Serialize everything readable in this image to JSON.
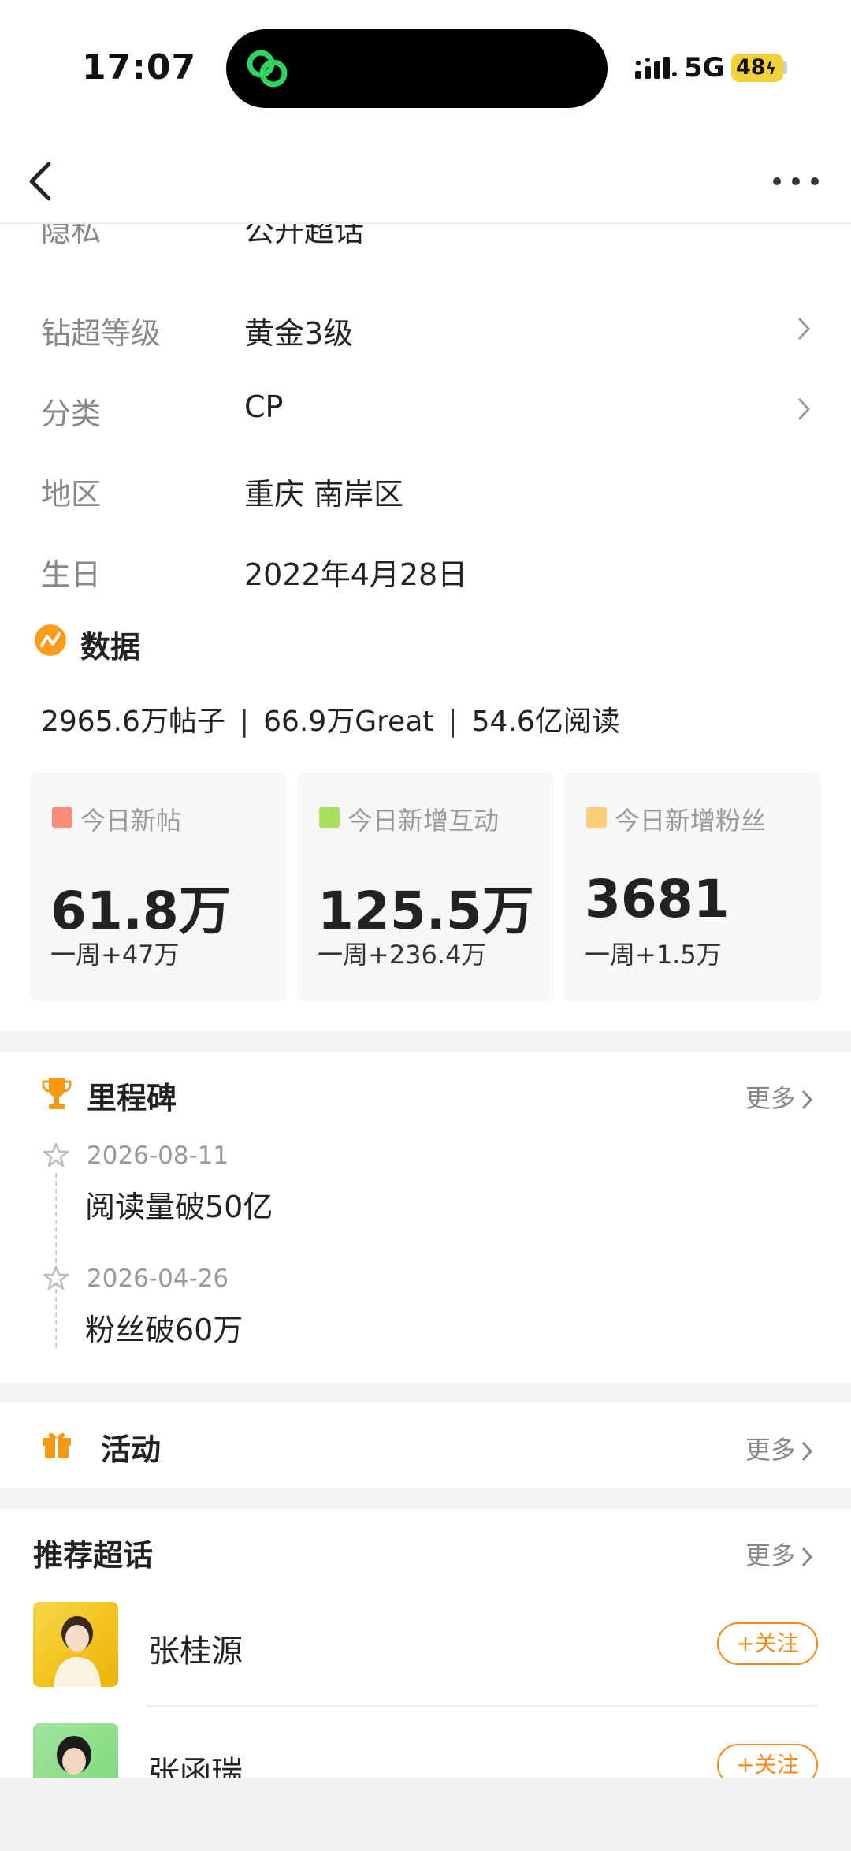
{
  "status_bar": {
    "time": "17:07",
    "network": "5G",
    "battery": "48"
  },
  "nav": {
    "back_icon": "back-chevron-icon",
    "more_icon": "more-dots-icon"
  },
  "info": {
    "rows": [
      {
        "label": "隐私",
        "value": "公开超话",
        "arrow": false
      },
      {
        "label": "钻超等级",
        "value": "黄金3级",
        "arrow": true
      },
      {
        "label": "分类",
        "value": "CP",
        "arrow": true
      },
      {
        "label": "地区",
        "value": "重庆 南岸区",
        "arrow": false
      },
      {
        "label": "生日",
        "value": "2022年4月28日",
        "arrow": false
      }
    ]
  },
  "data_section": {
    "title": "数据",
    "summary": {
      "posts": "2965.6万帖子",
      "sep": "|",
      "great": "66.9万Great",
      "reads": "54.6亿阅读"
    },
    "cards": [
      {
        "label": "今日新帖",
        "value": "61.8万",
        "week": "一周+47万",
        "color": "#f78c78"
      },
      {
        "label": "今日新增互动",
        "value": "125.5万",
        "week": "一周+236.4万",
        "color": "#a6e05c"
      },
      {
        "label": "今日新增粉丝",
        "value": "3681",
        "week": "一周+1.5万",
        "color": "#fbcc7a"
      }
    ]
  },
  "milestones": {
    "title": "里程碑",
    "more": "更多",
    "items": [
      {
        "date": "2026-08-11",
        "text": "阅读量破50亿"
      },
      {
        "date": "2026-04-26",
        "text": "粉丝破60万"
      }
    ]
  },
  "activity": {
    "title": "活动",
    "more": "更多"
  },
  "recommended": {
    "title": "推荐超话",
    "more": "更多",
    "items": [
      {
        "name": "张桂源",
        "follow": "+关注"
      },
      {
        "name": "张函瑞",
        "follow": "+关注"
      }
    ]
  },
  "colors": {
    "accent": "#f48a1c",
    "data_icon": "#ff9a1a",
    "battery": "#f2d13a",
    "island_icon": "#2fd35f"
  }
}
